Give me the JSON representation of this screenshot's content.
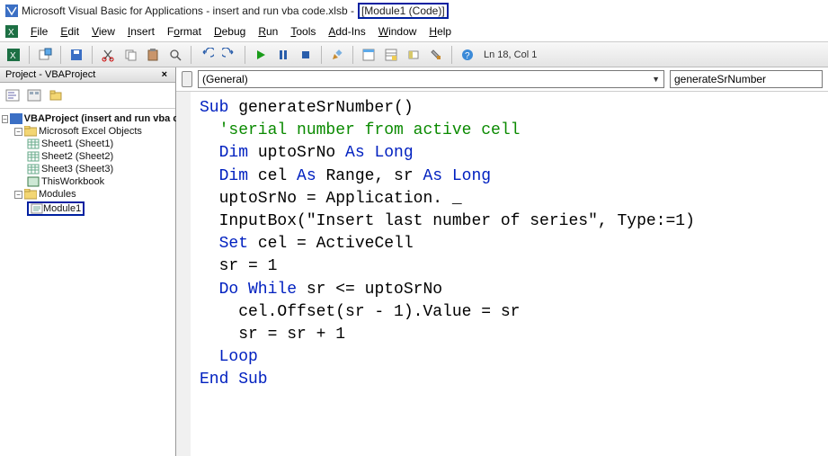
{
  "title": {
    "prefix": "Microsoft Visual Basic for Applications - insert and run vba code.xlsb - ",
    "highlight": "[Module1 (Code)]"
  },
  "menus": [
    "File",
    "Edit",
    "View",
    "Insert",
    "Format",
    "Debug",
    "Run",
    "Tools",
    "Add-Ins",
    "Window",
    "Help"
  ],
  "cursor_status": "Ln 18, Col 1",
  "project_panel": {
    "title": "Project - VBAProject",
    "root": "VBAProject (insert and run vba code.xlsb)",
    "excel_objects_label": "Microsoft Excel Objects",
    "sheets": [
      "Sheet1 (Sheet1)",
      "Sheet2 (Sheet2)",
      "Sheet3 (Sheet3)"
    ],
    "workbook": "ThisWorkbook",
    "modules_label": "Modules",
    "module_item": "Module1"
  },
  "dropdowns": {
    "left": "(General)",
    "right": "generateSrNumber"
  },
  "code": {
    "l1_a": "Sub",
    "l1_b": " generateSrNumber()",
    "l2": "  'serial number from active cell",
    "l3_a": "  Dim",
    "l3_b": " uptoSrNo ",
    "l3_c": "As Long",
    "l4_a": "  Dim",
    "l4_b": " cel ",
    "l4_c": "As",
    "l4_d": " Range, sr ",
    "l4_e": "As Long",
    "l5": "",
    "l6": "  uptoSrNo = Application. _",
    "l7": "  InputBox(\"Insert last number of series\", Type:=1)",
    "l8_a": "  Set",
    "l8_b": " cel = ActiveCell",
    "l9": "  sr = 1",
    "l10": "",
    "l11_a": "  Do While",
    "l11_b": " sr <= uptoSrNo",
    "l12": "    cel.Offset(sr - 1).Value = sr",
    "l13": "    sr = sr + 1",
    "l14": "  Loop",
    "l15": "End Sub"
  }
}
